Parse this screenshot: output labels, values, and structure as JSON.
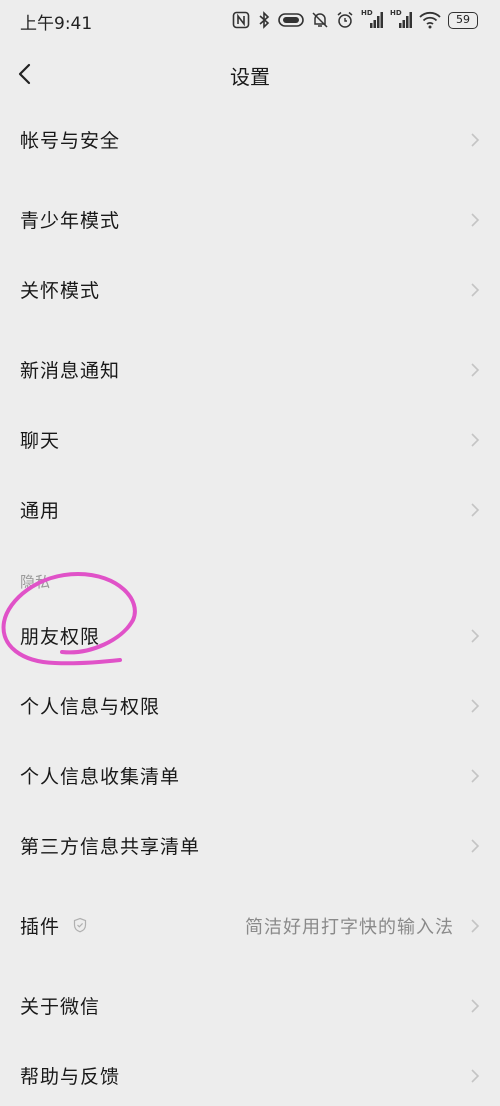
{
  "status_bar": {
    "time": "上午9:41",
    "icons": [
      "nfc-icon",
      "bluetooth-icon",
      "vibrate-icon",
      "mute-bell-icon",
      "alarm-icon",
      "hd-signal-icon",
      "hd-signal-icon",
      "wifi-icon",
      "battery-icon"
    ],
    "hd_label": "HD",
    "battery": "59"
  },
  "navbar": {
    "title": "设置",
    "back_icon": "back-chevron-icon"
  },
  "section": {
    "privacy": "隐私"
  },
  "rows": [
    {
      "label": "帐号与安全"
    },
    {
      "label": "青少年模式"
    },
    {
      "label": "关怀模式"
    },
    {
      "label": "新消息通知"
    },
    {
      "label": "聊天"
    },
    {
      "label": "通用"
    },
    {
      "label": "朋友权限"
    },
    {
      "label": "个人信息与权限"
    },
    {
      "label": "个人信息收集清单"
    },
    {
      "label": "第三方信息共享清单"
    },
    {
      "label": "插件",
      "value": "简洁好用打字快的输入法",
      "icon": "shield-icon"
    },
    {
      "label": "关于微信"
    },
    {
      "label": "帮助与反馈"
    }
  ],
  "chevron_icon": "chevron-right-icon",
  "annotation_color": "#e052c8"
}
